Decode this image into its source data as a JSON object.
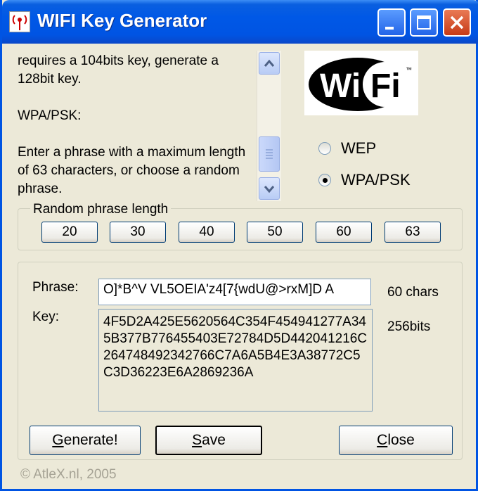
{
  "window": {
    "title": "WIFI Key Generator",
    "icon": "wifi-antenna-icon"
  },
  "description": {
    "lines": [
      "requires a 104bits key, generate a 128bit key.",
      "WPA/PSK:",
      "Enter a phrase with a maximum length of 63 characters, or choose a random phrase."
    ]
  },
  "logo": {
    "text_wi": "Wi",
    "text_fi": "Fi",
    "tm": "™"
  },
  "mode": {
    "options": [
      "WEP",
      "WPA/PSK"
    ],
    "selected": "WPA/PSK"
  },
  "random_length": {
    "legend": "Random phrase length",
    "buttons": [
      "20",
      "30",
      "40",
      "50",
      "60",
      "63"
    ]
  },
  "phrase": {
    "label": "Phrase:",
    "value": "O]*B^V VL5OEIA'z4[7{wdU@>rxM]D A",
    "char_count": "60 chars"
  },
  "key": {
    "label": "Key:",
    "value": "4F5D2A425E5620564C354F454941277A345B377B776455403E72784D5D442041216C264748492342766C7A6A5B4E3A38772C5C3D36223E6A2869236A",
    "bits": "256bits"
  },
  "actions": {
    "generate": {
      "first": "G",
      "rest": "enerate!"
    },
    "save": {
      "first": "S",
      "rest": "ave"
    },
    "close": {
      "first": "C",
      "rest": "lose"
    }
  },
  "footer": {
    "copyright": "© AtleX.nl, 2005"
  },
  "colors": {
    "titlebar": "#0054e3",
    "face": "#ece9d8",
    "close_button": "#d54a24"
  }
}
